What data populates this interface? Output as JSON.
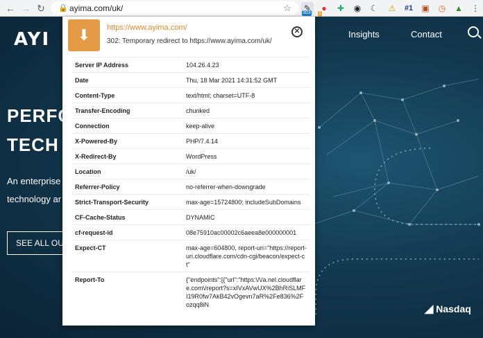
{
  "browser": {
    "url": "ayima.com/uk/",
    "extension_badge": "303",
    "extension_badge_2": "1",
    "extension_label_rank": "#1"
  },
  "site": {
    "logo": "AYI",
    "nav": [
      "Insights",
      "Contact"
    ],
    "hero_line1": "PERFO",
    "hero_line2": "TECH",
    "sub_line1": "An enterprise",
    "sub_line2": "technology ar",
    "cta": "SEE ALL OU",
    "nasdaq": "Nasdaq"
  },
  "popup": {
    "destination_url": "https://www.ayima.com/",
    "status": "302: Temporary redirect to https://www.ayima.com/uk/",
    "headers": [
      {
        "key": "Server IP Address",
        "value": "104.26.4.23"
      },
      {
        "key": "Date",
        "value": "Thu, 18 Mar 2021 14:31:52 GMT"
      },
      {
        "key": "Content-Type",
        "value": "text/html; charset=UTF-8"
      },
      {
        "key": "Transfer-Encoding",
        "value": "chunked"
      },
      {
        "key": "Connection",
        "value": "keep-alive"
      },
      {
        "key": "X-Powered-By",
        "value": "PHP/7.4.14"
      },
      {
        "key": "X-Redirect-By",
        "value": "WordPress"
      },
      {
        "key": "Location",
        "value": "/uk/"
      },
      {
        "key": "Referrer-Policy",
        "value": "no-referrer-when-downgrade"
      },
      {
        "key": "Strict-Transport-Security",
        "value": "max-age=15724800; includeSubDomains"
      },
      {
        "key": "CF-Cache-Status",
        "value": "DYNAMIC"
      },
      {
        "key": "cf-request-id",
        "value": "08e75910ac00002c6aeea8e000000001"
      },
      {
        "key": "Expect-CT",
        "value": "max-age=604800, report-uri=\"https://report-uri.cloudflare.com/cdn-cgi/beacon/expect-ct\""
      },
      {
        "key": "Report-To",
        "value": "{\"endpoints\":[{\"url\":\"https:\\/\\/a.nel.cloudflare.com\\/report?s=xIVxAVwUX%2BhRiSLMFI19R0fw7AkB42vOgevn7aR%2Fe836%2Fozqq8iN"
      }
    ]
  }
}
